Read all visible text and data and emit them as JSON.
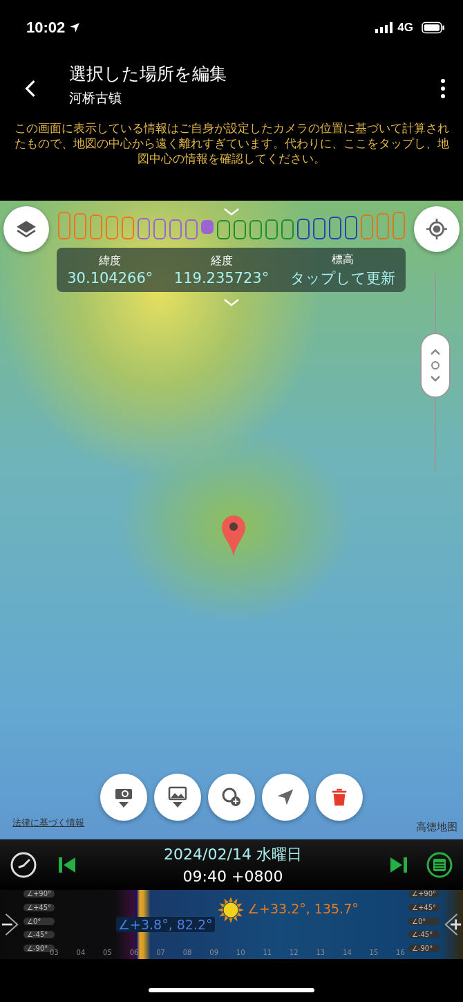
{
  "status_bar": {
    "time": "10:02",
    "network": "4G"
  },
  "header": {
    "title": "選択した場所を編集",
    "subtitle": "河桥古镇"
  },
  "notice": "この画面に表示している情報はご自身が設定したカメラの位置に基づいて計算されたもので、地図の中心から遠く離れすぎています。代わりに、ここをタップし、地図中心の情報を確認してください。",
  "color_scale": [
    {
      "color": "#f0731e",
      "selected": false
    },
    {
      "color": "#f0731e",
      "selected": false
    },
    {
      "color": "#f0731e",
      "selected": false
    },
    {
      "color": "#f0731e",
      "selected": false
    },
    {
      "color": "#f0731e",
      "selected": false
    },
    {
      "color": "#9a64d2",
      "selected": false
    },
    {
      "color": "#9a64d2",
      "selected": false
    },
    {
      "color": "#9a64d2",
      "selected": false
    },
    {
      "color": "#9a64d2",
      "selected": false
    },
    {
      "color": "#9a64d2",
      "selected": true
    },
    {
      "color": "#1f8f2a",
      "selected": false
    },
    {
      "color": "#1f8f2a",
      "selected": false
    },
    {
      "color": "#1f8f2a",
      "selected": false
    },
    {
      "color": "#1f8f2a",
      "selected": false
    },
    {
      "color": "#1f8f2a",
      "selected": false
    },
    {
      "color": "#2446a8",
      "selected": false
    },
    {
      "color": "#2446a8",
      "selected": false
    },
    {
      "color": "#2446a8",
      "selected": false
    },
    {
      "color": "#2446a8",
      "selected": false
    },
    {
      "color": "#d9781e",
      "selected": false
    },
    {
      "color": "#d9781e",
      "selected": false
    },
    {
      "color": "#d9781e",
      "selected": false
    }
  ],
  "coordinates": [
    {
      "label": "緯度",
      "value": "30.104266°"
    },
    {
      "label": "経度",
      "value": "119.235723°"
    },
    {
      "label": "標高",
      "value": "タップして更新"
    }
  ],
  "map": {
    "zoom": {
      "level": 0.45
    },
    "legal_link": "法律に基づく情報",
    "attribution": "高德地图"
  },
  "bottom": {
    "date": "2024/02/14 水曜日",
    "time": "09:40 +0800"
  },
  "timeline": {
    "angles_left": [
      "∠+90°",
      "∠+45°",
      "∠0°",
      "∠-45°",
      "∠-90°"
    ],
    "angles_right": [
      "∠+90°",
      "∠+45°",
      "∠0°",
      "∠-45°",
      "∠-90°"
    ],
    "hours": [
      "03",
      "04",
      "05",
      "06",
      "07",
      "08",
      "09",
      "10",
      "11",
      "12",
      "13",
      "14",
      "15",
      "16"
    ],
    "sunrise_reading": "∠+3.8°, 82.2°",
    "sun_reading": "∠+33.2°, 135.7°"
  }
}
